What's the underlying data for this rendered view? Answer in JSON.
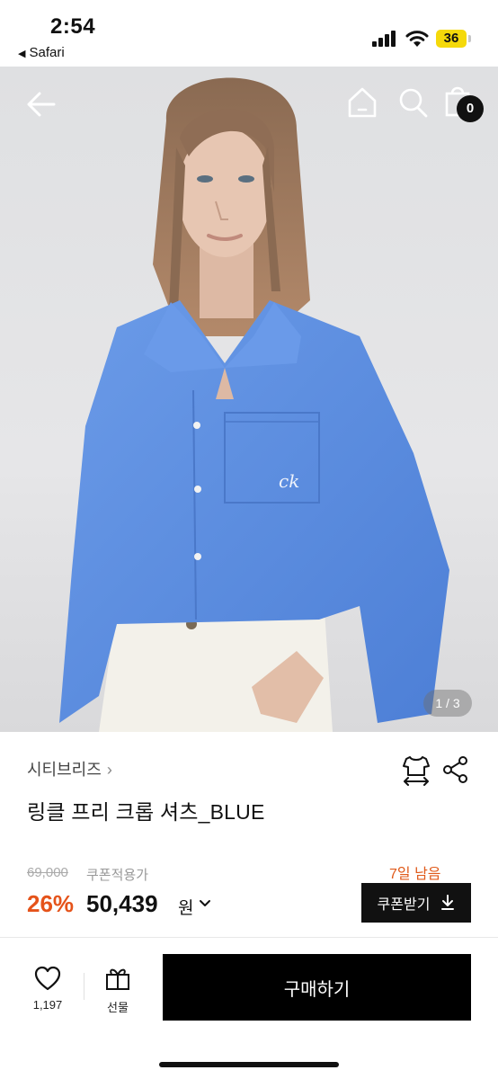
{
  "status_bar": {
    "time": "2:54",
    "back_app": "Safari",
    "battery": "36"
  },
  "hero": {
    "pager": "1 / 3",
    "bag_count": "0"
  },
  "product": {
    "brand": "시티브리즈",
    "title": "링클 프리 크롭 셔츠_BLUE",
    "original_price": "69,000",
    "coupon_applied": "쿠폰적용가",
    "days_left": "7일 남음",
    "discount": "26%",
    "sale_price": "50,439",
    "currency": "원",
    "coupon_button": "쿠폰받기"
  },
  "bottom_bar": {
    "likes": "1,197",
    "gift_label": "선물",
    "buy_label": "구매하기"
  },
  "colors": {
    "accent": "#e5531a",
    "primary": "#000000",
    "shirt": "#5b8de0"
  }
}
